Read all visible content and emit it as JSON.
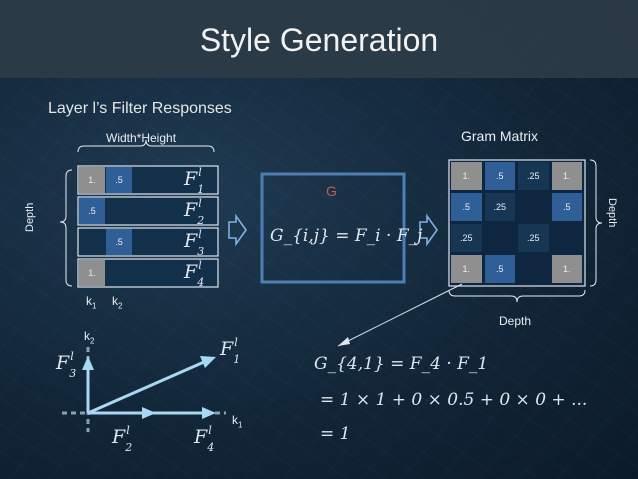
{
  "title": "Style Generation",
  "left_heading": "Layer l’s Filter Responses",
  "width_height_label": "Width*Height",
  "depth_label_left": "Depth",
  "depth_label_right": "Depth",
  "depth_label_bottom": "Depth",
  "gram_title": "Gram Matrix",
  "g_label": "G",
  "k_labels": {
    "k1": "k",
    "k1_sub": "1",
    "k2": "k",
    "k2_sub": "2"
  },
  "filter_rows": [
    {
      "cells": [
        "1.",
        ".5",
        ""
      ],
      "f_main": "F",
      "f_sub": "1",
      "f_sup": "l"
    },
    {
      "cells": [
        ".5",
        "",
        ""
      ],
      "f_main": "F",
      "f_sub": "2",
      "f_sup": "l"
    },
    {
      "cells": [
        "",
        ".5",
        ""
      ],
      "f_main": "F",
      "f_sub": "3",
      "f_sup": "l"
    },
    {
      "cells": [
        "1.",
        "",
        ""
      ],
      "f_main": "F",
      "f_sub": "4",
      "f_sup": "l"
    }
  ],
  "gram": [
    [
      "1.",
      ".5",
      ".25",
      "1."
    ],
    [
      ".5",
      ".25",
      "",
      ".5"
    ],
    [
      ".25",
      "",
      ".25",
      ""
    ],
    [
      "1.",
      ".5",
      "",
      "1."
    ]
  ],
  "gram_colors": [
    [
      "#8f8f8f",
      "#2f5f96",
      "#173654",
      "#8f8f8f"
    ],
    [
      "#2f5f96",
      "#173654",
      "#0f2640",
      "#2f5f96"
    ],
    [
      "#173654",
      "#0f2640",
      "#173654",
      "#0f2640"
    ],
    [
      "#8f8f8f",
      "#2f5f96",
      "#0f2640",
      "#8f8f8f"
    ]
  ],
  "formula_box": "G_{i,j} = F_i · F_j",
  "plot_labels": {
    "F1": "F",
    "F2": "F",
    "F3": "F",
    "F4": "F",
    "sup": "l"
  },
  "equation_lines": [
    "G_{4,1} = F_4 · F_1",
    "= 1 × 1 + 0 × 0.5 + 0 × 0 + ...",
    "= 1"
  ],
  "colors": {
    "accent": "#4d7fb5",
    "arrow": "#a9d9f2",
    "gray": "#8f8f8f"
  }
}
